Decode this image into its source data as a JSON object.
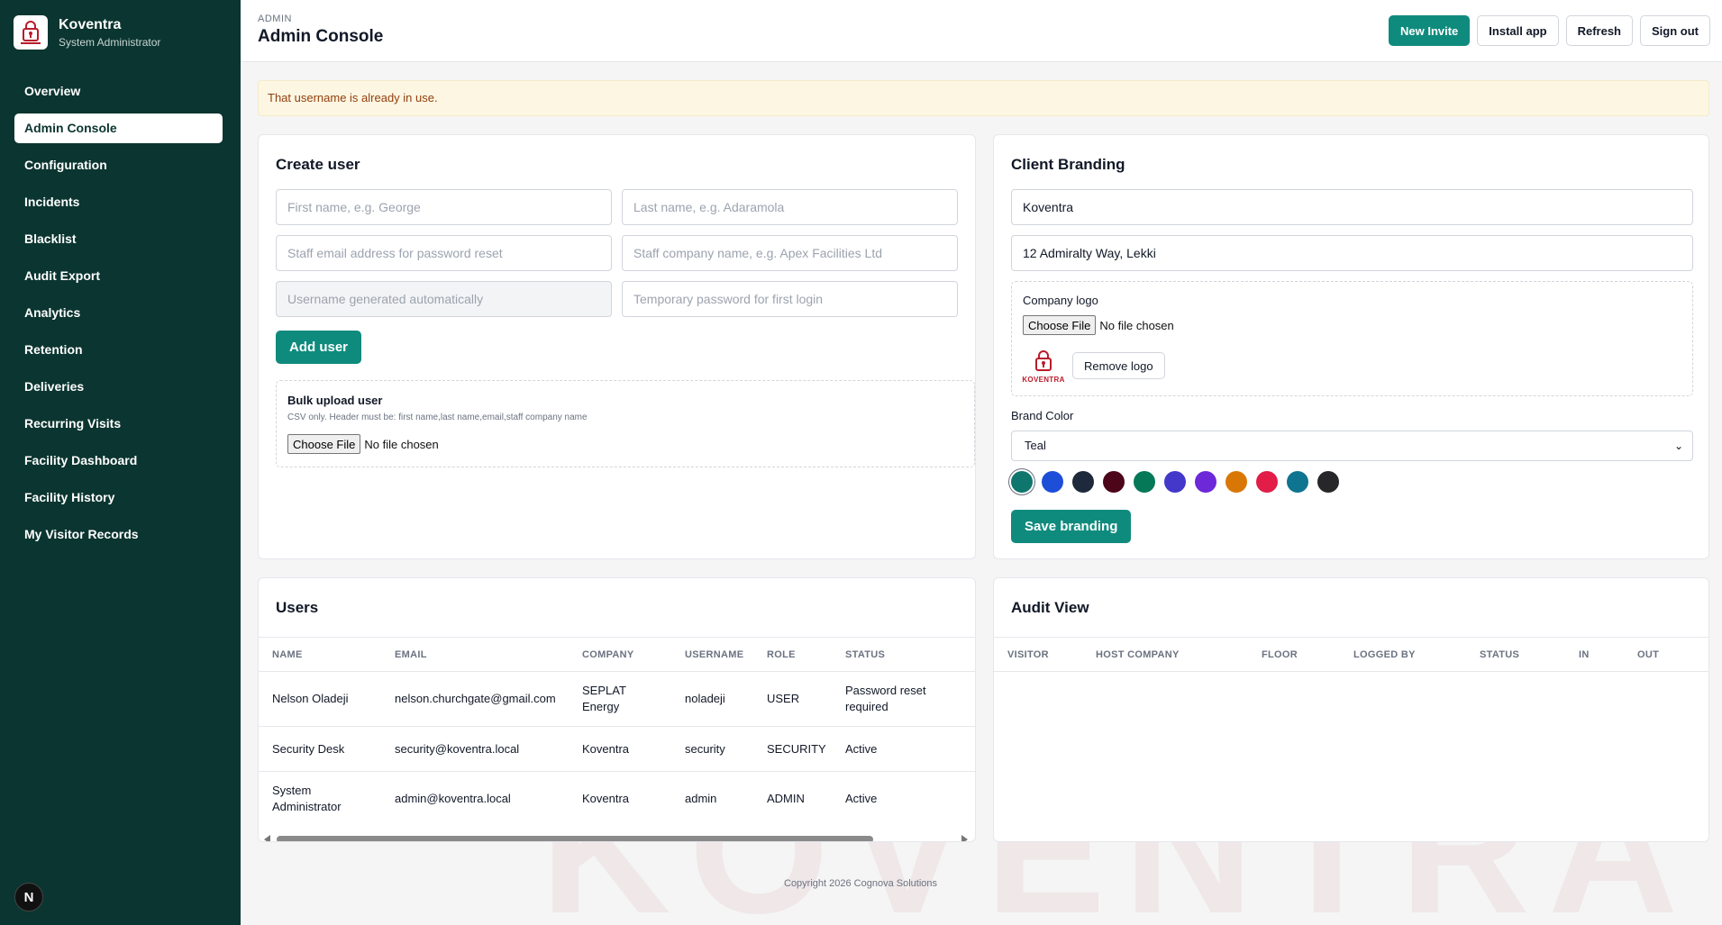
{
  "brand": {
    "name": "Koventra",
    "role": "System Administrator",
    "logo_text": "KOVENTRA"
  },
  "nav": {
    "items": [
      {
        "label": "Overview"
      },
      {
        "label": "Admin Console",
        "active": true
      },
      {
        "label": "Configuration"
      },
      {
        "label": "Incidents"
      },
      {
        "label": "Blacklist"
      },
      {
        "label": "Audit Export"
      },
      {
        "label": "Analytics"
      },
      {
        "label": "Retention"
      },
      {
        "label": "Deliveries"
      },
      {
        "label": "Recurring Visits"
      },
      {
        "label": "Facility Dashboard"
      },
      {
        "label": "Facility History"
      },
      {
        "label": "My Visitor Records"
      }
    ],
    "badge": "N"
  },
  "header": {
    "crumb": "ADMIN",
    "title": "Admin Console",
    "buttons": {
      "new_invite": "New Invite",
      "install_app": "Install app",
      "refresh": "Refresh",
      "sign_out": "Sign out"
    }
  },
  "alert": {
    "message": "That username is already in use."
  },
  "create_user": {
    "title": "Create user",
    "first_name_placeholder": "First name, e.g. George",
    "last_name_placeholder": "Last name, e.g. Adaramola",
    "email_placeholder": "Staff email address for password reset",
    "company_placeholder": "Staff company name, e.g. Apex Facilities Ltd",
    "username_placeholder": "Username generated automatically",
    "password_placeholder": "Temporary password for first login",
    "add_button": "Add user",
    "bulk": {
      "title": "Bulk upload user",
      "hint": "CSV only. Header must be: first name,last name,email,staff company name",
      "file_button": "Choose File",
      "file_status": "No file chosen"
    }
  },
  "branding": {
    "title": "Client Branding",
    "company_name": "Koventra",
    "address": "12 Admiralty Way, Lekki",
    "logo_label": "Company logo",
    "file_button": "Choose File",
    "file_status": "No file chosen",
    "remove_logo": "Remove logo",
    "color_label": "Brand Color",
    "color_value": "Teal",
    "swatches": [
      "#0f766e",
      "#1d4ed8",
      "#1e293b",
      "#4c0519",
      "#047857",
      "#4338ca",
      "#6d28d9",
      "#d97706",
      "#e11d48",
      "#0e7490",
      "#27272a"
    ],
    "save_button": "Save branding"
  },
  "users": {
    "title": "Users",
    "columns": [
      "NAME",
      "EMAIL",
      "COMPANY",
      "USERNAME",
      "ROLE",
      "STATUS"
    ],
    "rows": [
      [
        "Nelson Oladeji",
        "nelson.churchgate@gmail.com",
        "SEPLAT Energy",
        "noladeji",
        "USER",
        "Password reset required"
      ],
      [
        "Security Desk",
        "security@koventra.local",
        "Koventra",
        "security",
        "SECURITY",
        "Active"
      ],
      [
        "System Administrator",
        "admin@koventra.local",
        "Koventra",
        "admin",
        "ADMIN",
        "Active"
      ]
    ]
  },
  "audit": {
    "title": "Audit View",
    "columns": [
      "VISITOR",
      "HOST COMPANY",
      "FLOOR",
      "LOGGED BY",
      "STATUS",
      "IN",
      "OUT"
    ]
  },
  "watermark": "KOVENTRA",
  "footer": "Copyright 2026 Cognova Solutions",
  "colors": {
    "sidebar": "#0b3530",
    "accent": "#0f8b7e",
    "alert_bg": "#fdf6e3",
    "brand_red": "#b91c2b"
  }
}
